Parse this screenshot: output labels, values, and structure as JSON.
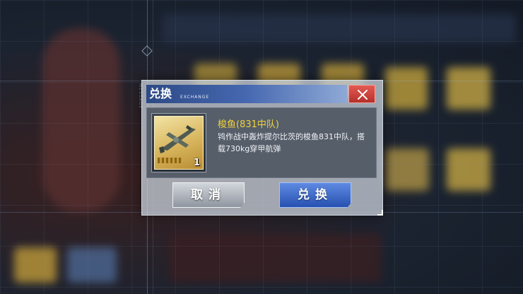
{
  "background": {
    "side_label": "MESSAGE"
  },
  "dialog": {
    "title": "兑换",
    "title_sub": "EXCHANGE",
    "close_icon": "close-x-icon",
    "accent_color": "#3e5fa8",
    "close_color": "#d4463f"
  },
  "item": {
    "icon": "aircraft-icon",
    "count": "1",
    "name": "梭鱼(831中队)",
    "description": "鸨作战中轰炸提尔比茨的梭鱼831中队，搭载730kg穿甲航弹",
    "name_color": "#f2d23a"
  },
  "buttons": {
    "cancel_label": "取消",
    "confirm_label": "兑换"
  }
}
